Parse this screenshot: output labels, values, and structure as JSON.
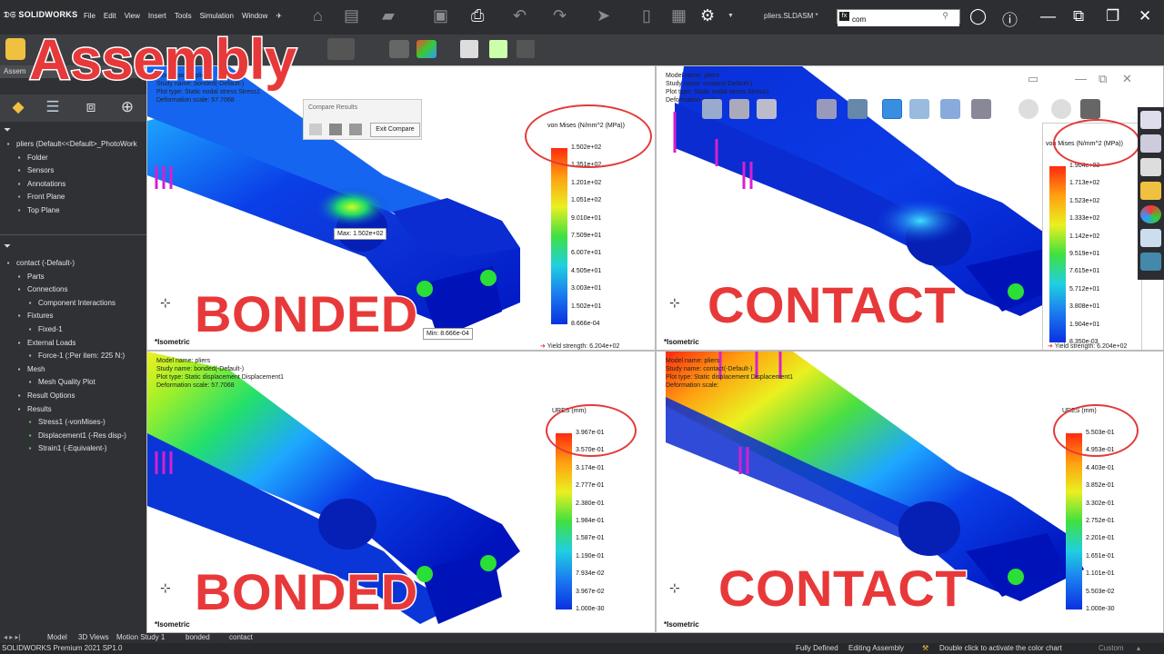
{
  "app": {
    "logo": "SOLIDWORKS",
    "document_title": "pliers.SLDASM *",
    "menu": [
      "File",
      "Edit",
      "View",
      "Insert",
      "Tools",
      "Simulation",
      "Window"
    ],
    "search_value": "com",
    "search_prefix_icon": "fx"
  },
  "overlay_title": "Assembly",
  "left_panel": {
    "tab_label": "Assem",
    "model_tree": [
      {
        "label": "pliers  (Default<<Default>_PhotoWork",
        "icon": "assembly-icon",
        "indent": 0
      },
      {
        "label": "Folder",
        "icon": "folder-icon",
        "indent": 1
      },
      {
        "label": "Sensors",
        "icon": "sensor-icon",
        "indent": 1
      },
      {
        "label": "Annotations",
        "icon": "annotation-icon",
        "indent": 1
      },
      {
        "label": "Front Plane",
        "icon": "plane-icon",
        "indent": 1
      },
      {
        "label": "Top Plane",
        "icon": "plane-icon",
        "indent": 1
      }
    ],
    "study_tree": [
      {
        "label": "contact (-Default-)",
        "icon": "study-icon",
        "indent": 0
      },
      {
        "label": "Parts",
        "icon": "parts-icon",
        "indent": 1
      },
      {
        "label": "Connections",
        "icon": "connections-icon",
        "indent": 1
      },
      {
        "label": "Component Interactions",
        "icon": "interaction-icon",
        "indent": 2
      },
      {
        "label": "Fixtures",
        "icon": "fixture-icon",
        "indent": 1
      },
      {
        "label": "Fixed-1",
        "icon": "fixed-icon",
        "indent": 2
      },
      {
        "label": "External Loads",
        "icon": "load-icon",
        "indent": 1
      },
      {
        "label": "Force-1 (:Per item: 225 N:)",
        "icon": "force-icon",
        "indent": 2
      },
      {
        "label": "Mesh",
        "icon": "mesh-icon",
        "indent": 1
      },
      {
        "label": "Mesh Quality Plot",
        "icon": "mesh-plot-icon",
        "indent": 2
      },
      {
        "label": "Result Options",
        "icon": "options-icon",
        "indent": 1
      },
      {
        "label": "Results",
        "icon": "results-icon",
        "indent": 1
      },
      {
        "label": "Stress1 (-vonMises-)",
        "icon": "plot-icon",
        "indent": 2
      },
      {
        "label": "Displacement1 (-Res disp-)",
        "icon": "plot-icon",
        "indent": 2
      },
      {
        "label": "Strain1 (-Equivalent-)",
        "icon": "plot-icon",
        "indent": 2
      }
    ]
  },
  "compare_dialog": {
    "title": "Compare Results",
    "exit_label": "Exit Compare"
  },
  "viewports": [
    {
      "id": "tl",
      "info": [
        "Model name: pliers",
        "Study name: bonded(-Default-)",
        "Plot type: Static nodal stress Stress1",
        "Deformation scale: 57.7068"
      ],
      "tag": "BONDED",
      "legend_title": "von Mises (N/mm^2 (MPa))",
      "ticks": [
        "1.502e+02",
        "1.351e+02",
        "1.201e+02",
        "1.051e+02",
        "9.010e+01",
        "7.509e+01",
        "6.007e+01",
        "4.505e+01",
        "3.003e+01",
        "1.502e+01",
        "8.666e-04"
      ],
      "yield": "Yield strength: 6.204e+02",
      "max_label": "Max:",
      "max_value": "1.502e+02",
      "min_label": "Min:",
      "min_value": "8.666e-04",
      "view_label": "*Isometric"
    },
    {
      "id": "tr",
      "info": [
        "Model name: pliers",
        "Study name: contact(-Default-)",
        "Plot type: Static nodal stress Stress1",
        "Deformation scale:"
      ],
      "tag": "CONTACT",
      "legend_title": "von Mises (N/mm^2 (MPa))",
      "ticks": [
        "1.904e+02",
        "1.713e+02",
        "1.523e+02",
        "1.333e+02",
        "1.142e+02",
        "9.519e+01",
        "7.615e+01",
        "5.712e+01",
        "3.808e+01",
        "1.904e+01",
        "8.350e-03"
      ],
      "yield": "Yield strength: 6.204e+02",
      "view_label": "*Isometric"
    },
    {
      "id": "bl",
      "info": [
        "Model name: pliers",
        "Study name: bonded(-Default-)",
        "Plot type: Static displacement Displacement1",
        "Deformation scale: 57.7068"
      ],
      "tag": "BONDED",
      "legend_title": "URES (mm)",
      "ticks": [
        "3.967e-01",
        "3.570e-01",
        "3.174e-01",
        "2.777e-01",
        "2.380e-01",
        "1.984e-01",
        "1.587e-01",
        "1.190e-01",
        "7.934e-02",
        "3.967e-02",
        "1.000e-30"
      ],
      "view_label": "*Isometric"
    },
    {
      "id": "br",
      "info": [
        "Model name: pliers",
        "Study name: contact(-Default-)",
        "Plot type: Static displacement Displacement1",
        "Deformation scale:"
      ],
      "tag": "CONTACT",
      "legend_title": "URES (mm)",
      "ticks": [
        "5.503e-01",
        "4.953e-01",
        "4.403e-01",
        "3.852e-01",
        "3.302e-01",
        "2.752e-01",
        "2.201e-01",
        "1.651e-01",
        "1.101e-01",
        "5.503e-02",
        "1.000e-30"
      ],
      "view_label": "*Isometric"
    }
  ],
  "bottom_tabs": [
    "Model",
    "3D Views",
    "Motion Study 1",
    "bonded",
    "contact"
  ],
  "status": {
    "product": "SOLIDWORKS Premium 2021 SP1.0",
    "defined": "Fully Defined",
    "mode": "Editing Assembly",
    "hint": "Double click to activate the color chart",
    "units": "Custom"
  },
  "colors": {
    "accent_red": "#e8393a",
    "chrome_dark": "#2c2e31",
    "selection_blue": "#1d6fd8"
  }
}
